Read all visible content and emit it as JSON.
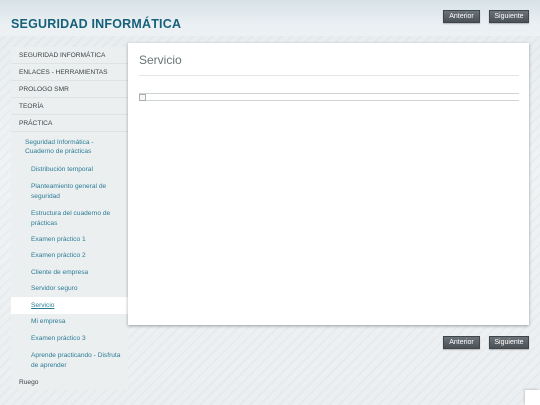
{
  "site": {
    "title": "SEGURIDAD INFORMÁTICA"
  },
  "nav": {
    "prev_label": "Anterior",
    "next_label": "Siguiente"
  },
  "sidebar": {
    "items": [
      {
        "label": "SEGURIDAD INFORMÁTICA"
      },
      {
        "label": "ENLACES - HERRAMIENTAS"
      },
      {
        "label": "PROLOGO SMR"
      },
      {
        "label": "TEORÍA"
      },
      {
        "label": "PRÁCTICA"
      }
    ],
    "subheading": "Seguridad Informática - Cuaderno de prácticas",
    "subitems": [
      {
        "label": "Distribución temporal"
      },
      {
        "label": "Planteamiento general de seguridad"
      },
      {
        "label": "Estructura del cuaderno de prácticas"
      },
      {
        "label": "Examen práctico 1"
      },
      {
        "label": "Examen práctico 2"
      },
      {
        "label": "Cliente de empresa"
      },
      {
        "label": "Servidor seguro"
      },
      {
        "label": "Servicio",
        "active": true
      },
      {
        "label": "Mi empresa"
      },
      {
        "label": "Examen práctico 3"
      },
      {
        "label": "Aprende practicando - Disfruta de aprender"
      }
    ],
    "footer_item": "Ruego"
  },
  "content": {
    "title": "Servicio"
  }
}
